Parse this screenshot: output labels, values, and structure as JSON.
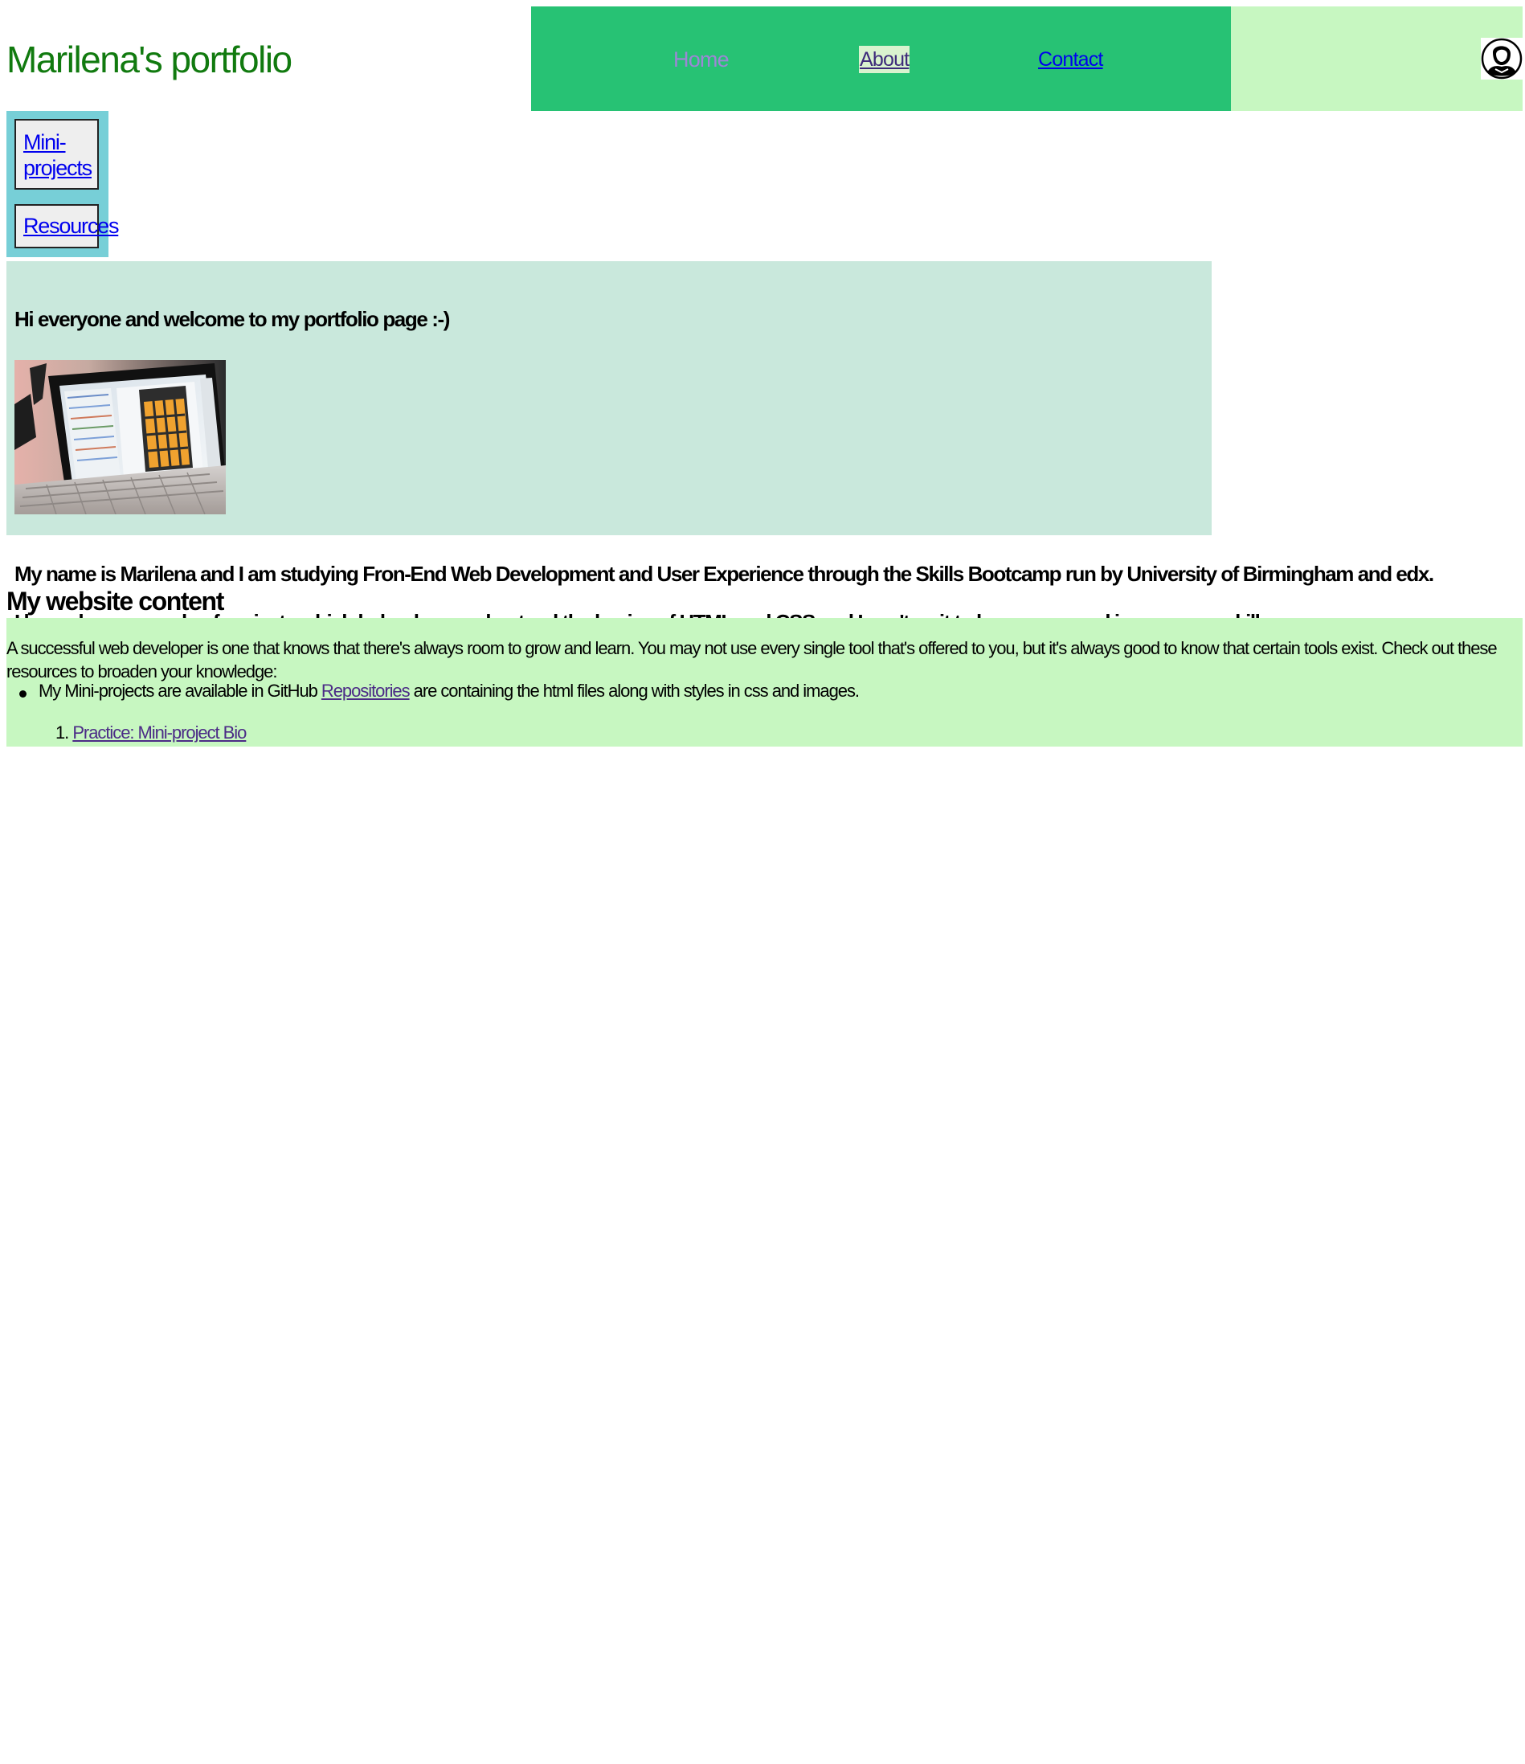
{
  "header": {
    "site_title": "Marilena's portfolio",
    "nav": [
      {
        "label": "Home"
      },
      {
        "label": "About"
      },
      {
        "label": "Contact"
      }
    ],
    "avatar_icon": "user-avatar-icon"
  },
  "sidebar": {
    "items": [
      {
        "label": "Mini-projects"
      },
      {
        "label": "Resources"
      }
    ]
  },
  "welcome": {
    "heading": "Hi everyone and welcome to my portfolio page :-)",
    "image_icon": "laptop-calculator-image"
  },
  "intro": {
    "line1": "My name is Marilena and I am studying Fron-End Web Development and User Experience through the Skills Bootcamp run by University of Birmingham and edx.",
    "line2": "I have done a couple of projects which helped me understand the basics of HTML and CSS and I can't wait to learn more and improve my skills."
  },
  "content": {
    "heading": "My website content",
    "description": "A successful web developer is one that knows that there's always room to grow and learn. You may not use every single tool that's offered to you, but it's always good to know that certain tools exist. Check out these resources to broaden your knowledge:",
    "bullet_before": "My Mini-projects are available in GitHub ",
    "bullet_link": "Repositories",
    "bullet_after": " are containing the html files along with styles in css and images.",
    "numbered_marker": "1.",
    "numbered_link": "Practice: Mini-project Bio"
  },
  "colors": {
    "title_green": "#117a0f",
    "nav_green": "#27c274",
    "light_green": "#c7f7c1",
    "sidebar_teal": "#77cfd7",
    "welcome_mint": "#c9e8dc"
  }
}
